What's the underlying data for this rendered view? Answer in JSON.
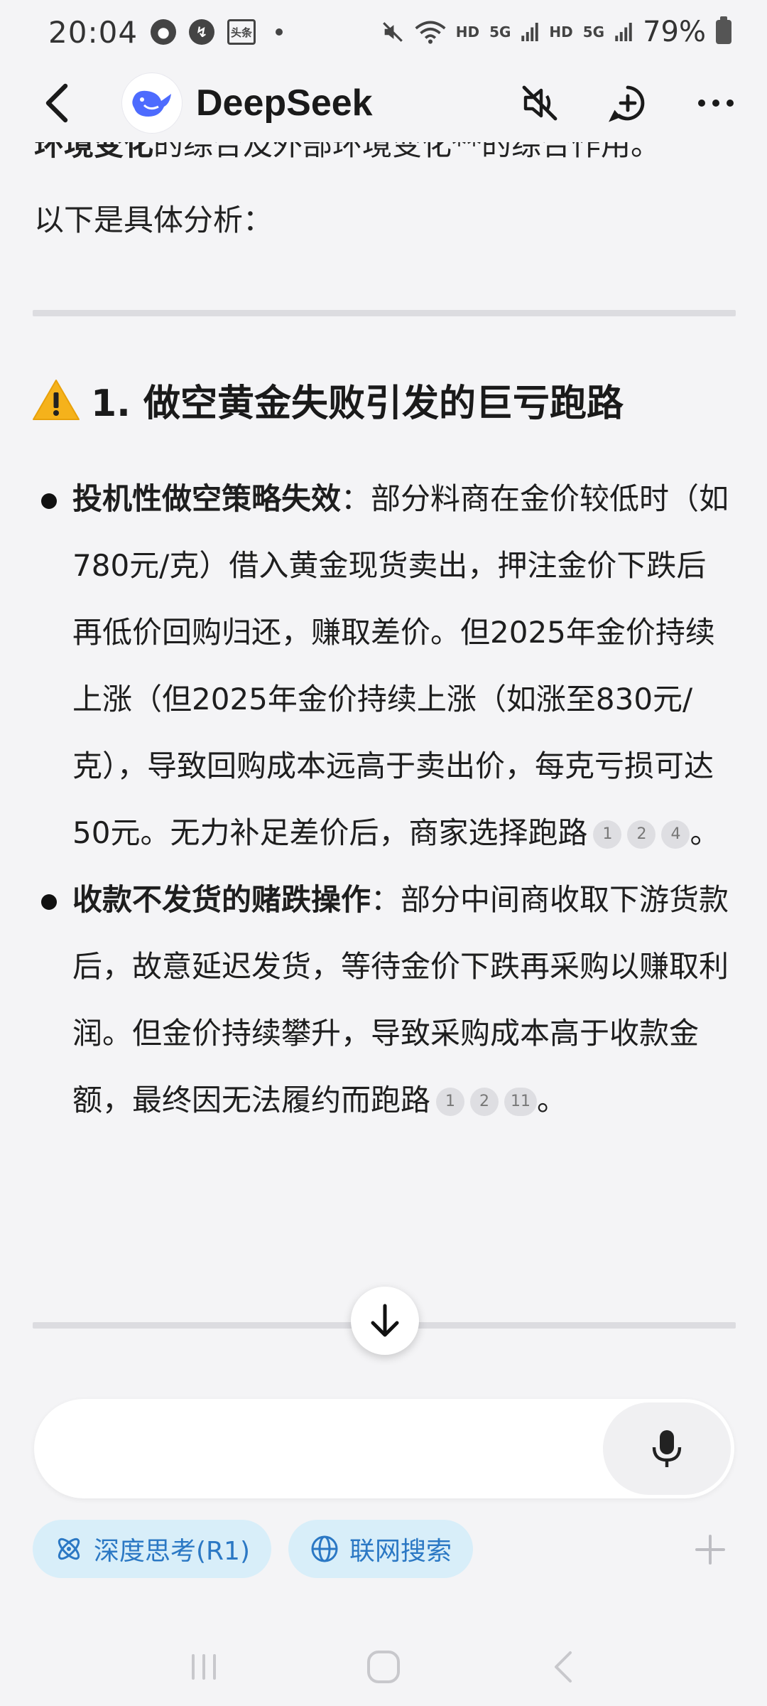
{
  "status_bar": {
    "time": "20:04",
    "toutiao_label": "头条",
    "network_hd": "HD",
    "network_5g": "5G",
    "battery": "79%"
  },
  "header": {
    "title": "DeepSeek"
  },
  "content": {
    "cut_line_bold": "环境变化",
    "cut_line_rest": "的综合及外部环境变化**的综合作用。",
    "intro": "以下是具体分析：",
    "section_title": "1. 做空黄金失败引发的巨亏跑路",
    "bullets": [
      {
        "bold": "投机性做空策略失效",
        "text": "：部分料商在金价较低时（如780元/克）借入黄金现货卖出，押注金价下跌后再低价回购归还，赚取差价。但2025年金价持续上涨（但2025年金价持续上涨（如涨至830元/克），导致回购成本远高于卖出价，每克亏损可达50元。无力补足差价后，商家选择跑路",
        "citations": [
          "1",
          "2",
          "4"
        ],
        "end": "。"
      },
      {
        "bold": "收款不发货的赌跌操作",
        "text": "：部分中间商收取下游货款后，故意延迟发货，等待金价下跌再采购以赚取利润。但金价持续攀升，导致采购成本高于收款金额，最终因无法履约而跑路",
        "citations": [
          "1",
          "2",
          "11"
        ],
        "end": "。"
      }
    ]
  },
  "input": {
    "placeholder": ""
  },
  "chips": {
    "deep_think": "深度思考(R1)",
    "web_search": "联网搜索"
  },
  "colors": {
    "accent": "#2b78c4",
    "chip_bg": "#d8eef9",
    "logo_blue": "#4d6bfe"
  }
}
